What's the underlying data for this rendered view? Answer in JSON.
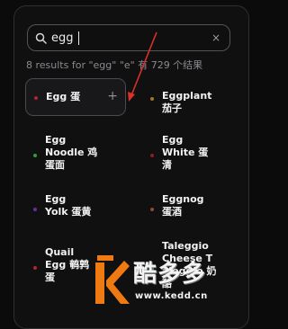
{
  "search": {
    "value": "egg",
    "clear_label": "×"
  },
  "summary": {
    "text": "8 results for \"egg\"   \"e\" 有 729 个结果"
  },
  "items": [
    {
      "label": "Egg  蛋",
      "dot_color": "#b3262c",
      "selected": true,
      "action_label": "+"
    },
    {
      "label": "Eggplant\n茄子",
      "dot_color": "#a0752b",
      "selected": false
    },
    {
      "label": "Egg\nNoodle  鸡\n蛋面",
      "dot_color": "#2f9e3a",
      "selected": false
    },
    {
      "label": "Egg\nWhite  蛋\n清",
      "dot_color": "#8c1d24",
      "selected": false
    },
    {
      "label": "Egg\nYolk  蛋黄",
      "dot_color": "#6a2aa8",
      "selected": false
    },
    {
      "label": "Eggnog\n蛋酒",
      "dot_color": "#8a4a34",
      "selected": false
    },
    {
      "label": "Quail\nEgg  鹌鹑\n蛋",
      "dot_color": "#b3262c",
      "selected": false
    },
    {
      "label": "Taleggio\nCheese  T\naleggio 奶\n酪",
      "dot_color": "#2f9e3a",
      "selected": false
    }
  ],
  "watermark": {
    "text": "酷多多",
    "url": "www.kedd.cn"
  },
  "colors": {
    "accent_arrow": "#d9302a",
    "watermark_orange": "#f07a12"
  }
}
